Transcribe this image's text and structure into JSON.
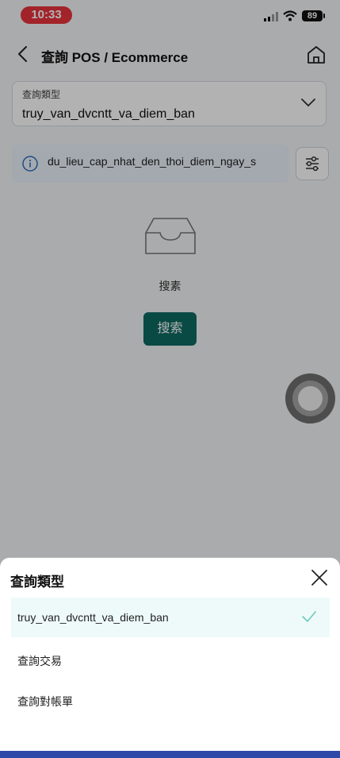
{
  "status_bar": {
    "time": "10:33",
    "battery": "89"
  },
  "header": {
    "title": "查詢 POS / Ecommerce"
  },
  "query_type": {
    "label": "查詢類型",
    "value": "truy_van_dvcntt_va_diem_ban"
  },
  "info": {
    "text": "du_lieu_cap_nhat_den_thoi_diem_ngay_s"
  },
  "empty_state": {
    "text": "搜素"
  },
  "search_button": {
    "label": "搜索"
  },
  "sheet": {
    "title": "查詢類型",
    "options": [
      {
        "label": "truy_van_dvcntt_va_diem_ban",
        "selected": true
      },
      {
        "label": "查詢交易",
        "selected": false
      },
      {
        "label": "查詢對帳單",
        "selected": false
      }
    ]
  },
  "colors": {
    "primary": "#0f6a63",
    "accent_check": "#6dcabf",
    "bottom_bar": "#2f49a8"
  }
}
